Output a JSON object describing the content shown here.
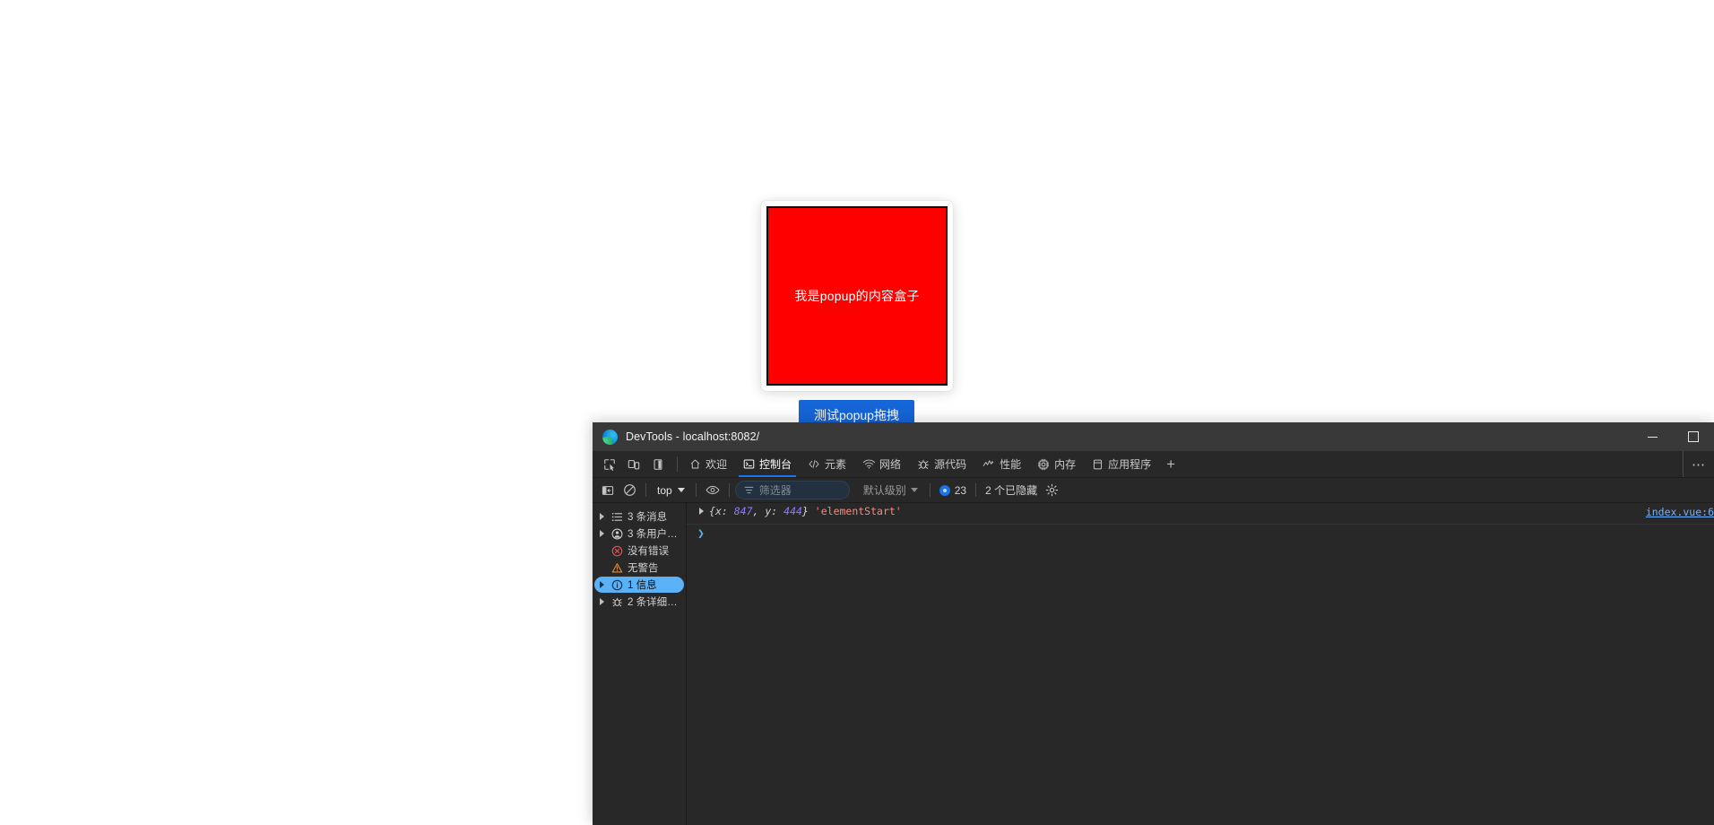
{
  "page": {
    "popup": {
      "content_text": "我是popup的内容盒子",
      "content_bg": "#fe0000",
      "border_color": "#0a0a0a",
      "shell_bg": "#fefefe"
    },
    "trigger_button": {
      "label": "测试popup拖拽",
      "bg": "#1565d8"
    }
  },
  "devtools": {
    "titlebar": {
      "title": "DevTools - localhost:8082/",
      "logo_icon": "edge-logo-icon",
      "minimize_label": "最小化",
      "maximize_label": "最大化"
    },
    "tabbar": {
      "tool_icons": [
        {
          "name": "inspect-element-icon"
        },
        {
          "name": "device-toolbar-icon"
        },
        {
          "name": "dock-side-icon"
        }
      ],
      "tabs": [
        {
          "label": "欢迎",
          "icon": "home-icon",
          "active": false
        },
        {
          "label": "控制台",
          "icon": "console-icon",
          "active": true
        },
        {
          "label": "元素",
          "icon": "code-brackets-icon",
          "active": false
        },
        {
          "label": "网络",
          "icon": "network-wifi-icon",
          "active": false
        },
        {
          "label": "源代码",
          "icon": "sources-bug-icon",
          "active": false
        },
        {
          "label": "性能",
          "icon": "performance-gauge-icon",
          "active": false
        },
        {
          "label": "内存",
          "icon": "memory-chip-icon",
          "active": false
        },
        {
          "label": "应用程序",
          "icon": "application-box-icon",
          "active": false
        }
      ],
      "add_tab_label": "+",
      "more_tools_label": "⋯",
      "active_underline_color": "#1a73e8"
    },
    "console_toolbar": {
      "sidebar_toggle_icon": "console-sidebar-toggle-icon",
      "clear_console_icon": "clear-console-icon",
      "context_selector": "top",
      "live_expression_icon": "eye-icon",
      "filter_icon": "filter-icon",
      "filter_placeholder": "筛选器",
      "filter_value": "",
      "level_selector": "默认级别",
      "issues_count": "23",
      "hidden_label": "2 个已隐藏",
      "settings_icon": "gear-icon"
    },
    "sidebar": {
      "items": [
        {
          "label": "3 条消息",
          "icon": "messages-list-icon",
          "expandable": true,
          "selected": false
        },
        {
          "label": "3 条用户消…",
          "icon": "user-message-icon",
          "expandable": true,
          "selected": false
        },
        {
          "label": "没有错误",
          "icon": "error-circle-icon",
          "expandable": false,
          "selected": false
        },
        {
          "label": "无警告",
          "icon": "warning-triangle-icon",
          "expandable": false,
          "selected": false
        },
        {
          "label": "1 信息",
          "icon": "info-circle-icon",
          "expandable": true,
          "selected": true
        },
        {
          "label": "2 条详细消…",
          "icon": "verbose-bug-icon",
          "expandable": true,
          "selected": false
        }
      ],
      "selected_bg": "#5ab1f5"
    },
    "console": {
      "messages": [
        {
          "expandable": true,
          "object_open": "{",
          "key_x": "x: ",
          "value_x": "847",
          "comma": ", ",
          "key_y": "y: ",
          "value_y": "444",
          "object_close": "}",
          "string_value": "'elementStart'",
          "source": "index.vue:6"
        }
      ],
      "prompt_chevron": "❯",
      "prompt_value": ""
    }
  }
}
